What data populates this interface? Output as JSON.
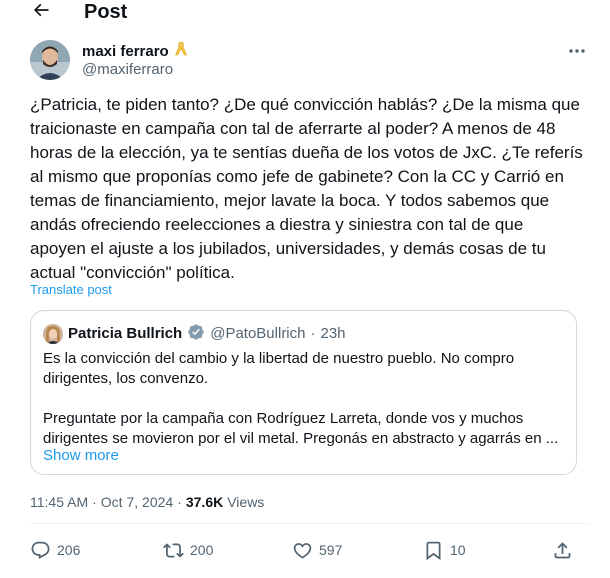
{
  "header": {
    "title": "Post"
  },
  "author": {
    "name": "maxi ferraro",
    "handle": "@maxiferraro"
  },
  "post": {
    "text": "¿Patricia, te piden tanto? ¿De qué convicción hablás? ¿De la misma que\ntraicionaste en campaña con tal de aferrarte al poder? A menos de 48\nhoras de la elección, ya te sentías dueña de los votos de JxC. ¿Te referís\nal mismo que proponías como jefe de gabinete? Con la CC y Carrió en\ntemas de financiamiento, mejor lavate la boca. Y todos sabemos que\nandás ofreciendo reelecciones a diestra y siniestra con tal de que\napoyen el ajuste a los jubilados, universidades, y demás cosas de tu\nactual \"convicción\" política.",
    "translate_label": "Translate post"
  },
  "quote": {
    "name": "Patricia Bullrich",
    "handle": "@PatoBullrich",
    "separator": "·",
    "time": "23h",
    "line1": "Es la convicción del cambio y la libertad de nuestro pueblo. No compro",
    "line2": "dirigentes, los convenzo.",
    "line3": "Preguntate por la campaña con Rodríguez Larreta, donde vos y muchos",
    "line4": "dirigentes se movieron por el vil metal. Pregonás en abstracto y agarrás en ...",
    "show_more": "Show more"
  },
  "meta": {
    "time": "11:45 AM",
    "sep1": "·",
    "date": "Oct 7, 2024",
    "sep2": "·",
    "views_count": "37.6K",
    "views_label": "Views"
  },
  "actions": {
    "replies": "206",
    "reposts": "200",
    "likes": "597",
    "bookmarks": "10"
  },
  "colors": {
    "accent": "#1d9bf0",
    "text": "#0f1419",
    "secondary": "#536471",
    "verified": "#829aab",
    "ribbon": "#f4c542"
  },
  "icons": {
    "back": "arrow-left-icon",
    "more": "more-dots-icon",
    "ribbon": "yellow-ribbon-icon",
    "verified": "verified-badge-icon",
    "reply": "reply-icon",
    "repost": "repost-icon",
    "like": "heart-icon",
    "bookmark": "bookmark-icon",
    "share": "share-icon"
  }
}
